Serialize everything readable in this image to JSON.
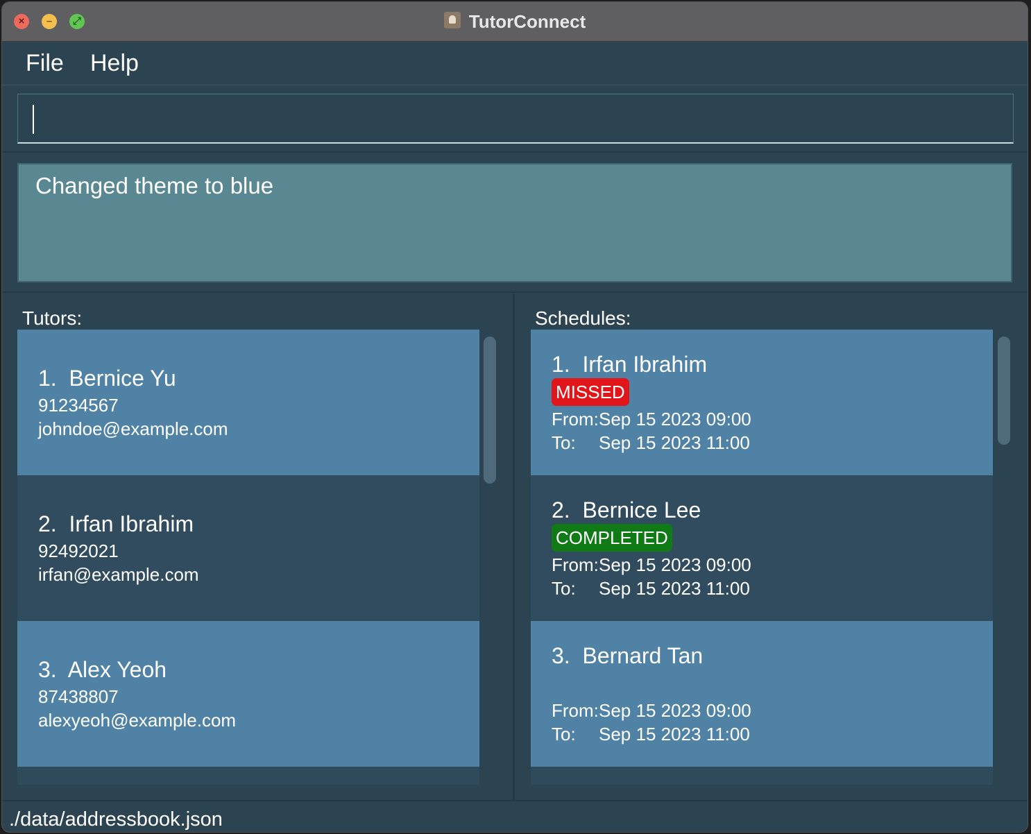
{
  "window": {
    "title": "TutorConnect"
  },
  "menu": {
    "file": "File",
    "help": "Help"
  },
  "command": {
    "value": ""
  },
  "result": {
    "text": "Changed theme to blue"
  },
  "tutors": {
    "label": "Tutors:",
    "items": [
      {
        "index": "1.",
        "name": "Bernice Yu",
        "phone": "91234567",
        "email": "johndoe@example.com"
      },
      {
        "index": "2.",
        "name": "Irfan Ibrahim",
        "phone": "92492021",
        "email": "irfan@example.com"
      },
      {
        "index": "3.",
        "name": "Alex Yeoh",
        "phone": "87438807",
        "email": "alexyeoh@example.com"
      }
    ]
  },
  "schedules": {
    "label": "Schedules:",
    "from_label": "From:",
    "to_label": "To:",
    "items": [
      {
        "index": "1.",
        "name": "Irfan Ibrahim",
        "status": "MISSED",
        "from": "Sep 15 2023 09:00",
        "to": "Sep 15 2023 11:00"
      },
      {
        "index": "2.",
        "name": "Bernice Lee",
        "status": "COMPLETED",
        "from": "Sep 15 2023 09:00",
        "to": "Sep 15 2023 11:00"
      },
      {
        "index": "3.",
        "name": "Bernard Tan",
        "status": "",
        "from": "Sep 15 2023 09:00",
        "to": "Sep 15 2023 11:00"
      }
    ]
  },
  "status": {
    "path": "./data/addressbook.json"
  },
  "colors": {
    "background": "#2c4352",
    "card_light": "#5082a5",
    "card_dark": "#304c5e",
    "result_box": "#5a8892",
    "missed": "#e0161a",
    "completed": "#107a16"
  }
}
